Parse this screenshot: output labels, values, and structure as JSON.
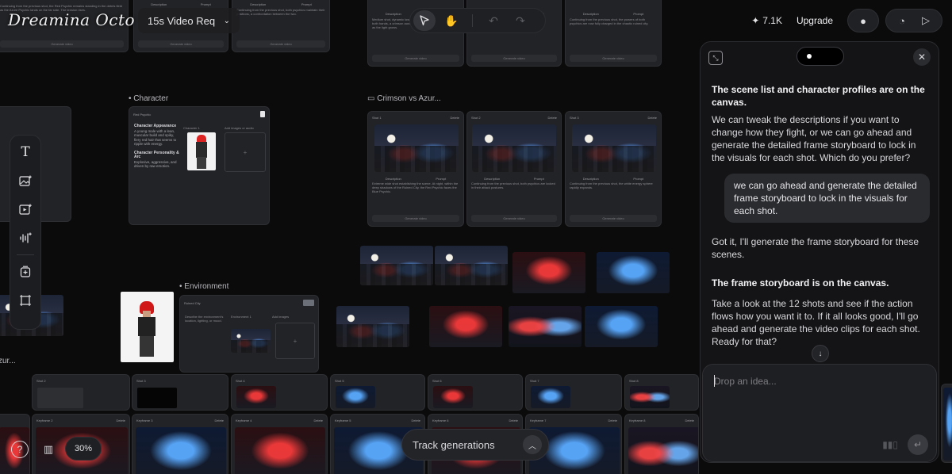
{
  "header": {
    "logo": "Dreamina Octo",
    "project_mode": "15s Video Req",
    "credits": "7.1K",
    "upgrade": "Upgrade"
  },
  "canvas": {
    "sections": {
      "character": "Character",
      "environment": "Environment",
      "scene_group": "Crimson vs Azur...",
      "left_cut": "zur..."
    },
    "character_card": {
      "name": "Red Psychic",
      "appearance_heading": "Character Appearance",
      "personality_heading": "Character Personality & Arc",
      "slot1": "Character 1",
      "slot2": "Add images or audio"
    },
    "environment_card": {
      "name": "Ruined City",
      "slot1": "Environment 1",
      "slot2": "Add images"
    },
    "shots": [
      "Shot 1",
      "Shot 2",
      "Shot 3"
    ],
    "shot_delete": "Delete",
    "generate_video": "Generate video",
    "desc_tab": "Description",
    "prompt_tab": "Prompt",
    "bottom_shots": [
      "Shot 2",
      "Shot 3",
      "Shot 4",
      "Shot 5",
      "Shot 6",
      "Shot 7",
      "Shot 8"
    ],
    "keyframes": [
      "Keyframe 2",
      "Keyframe 3",
      "Keyframe 4",
      "Keyframe 5",
      "Keyframe 6",
      "Keyframe 7",
      "Keyframe 8"
    ],
    "zoom": "30%",
    "track_generations": "Track generations"
  },
  "chat": {
    "messages": [
      {
        "bold": true,
        "text": "The scene list and character profiles are on the canvas."
      },
      {
        "bold": false,
        "text": "We can tweak the descriptions if you want to change how they fight, or we can go ahead and generate the detailed frame storyboard to lock in the visuals for each shot. Which do you prefer?"
      },
      {
        "user": true,
        "text": "we can go ahead and generate the detailed frame storyboard to lock in the visuals for each shot."
      },
      {
        "bold": false,
        "text": "Got it, I'll generate the frame storyboard for these scenes."
      },
      {
        "bold": true,
        "text": "The frame storyboard is on the canvas."
      },
      {
        "bold": false,
        "text": "Take a look at the 12 shots and see if the action flows how you want it to. If it all looks good, I'll go ahead and generate the video clips for each shot. Ready for that?"
      }
    ],
    "input_placeholder": "Drop an idea..."
  },
  "icons": {
    "text_tool": "text-icon",
    "image_tool": "image-add-icon",
    "video_tool": "video-add-icon",
    "audio_tool": "audio-icon",
    "frame_tool": "frame-icon"
  }
}
